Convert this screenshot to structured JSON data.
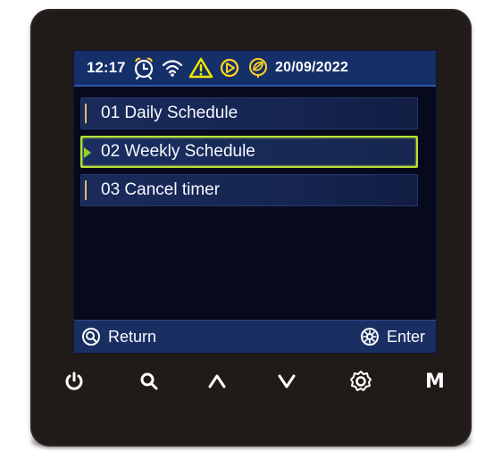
{
  "status_bar": {
    "time": "12:17",
    "date": "20/09/2022",
    "icons": [
      "alarm-clock-icon",
      "wifi-icon",
      "warning-icon",
      "play-icon",
      "eco-leaf-icon"
    ],
    "colors": {
      "background": "#152f69",
      "text": "#ffffff",
      "warning": "#f2e500",
      "accent": "#ffd21f"
    }
  },
  "menu": {
    "items": [
      {
        "label": "01 Daily Schedule",
        "selected": false
      },
      {
        "label": "02 Weekly Schedule",
        "selected": true
      },
      {
        "label": "03 Cancel timer",
        "selected": false
      }
    ],
    "selected_color": "#b8e234"
  },
  "footer": {
    "return_label": "Return",
    "enter_label": "Enter",
    "return_icon": "search-icon",
    "enter_icon": "settings-icon"
  },
  "hardware_buttons": [
    {
      "name": "power-button",
      "icon": "power-icon"
    },
    {
      "name": "search-button",
      "icon": "search-icon"
    },
    {
      "name": "up-button",
      "icon": "chevron-up-icon"
    },
    {
      "name": "down-button",
      "icon": "chevron-down-icon"
    },
    {
      "name": "settings-button",
      "icon": "gear-icon"
    },
    {
      "name": "mode-button",
      "label": "M"
    }
  ]
}
